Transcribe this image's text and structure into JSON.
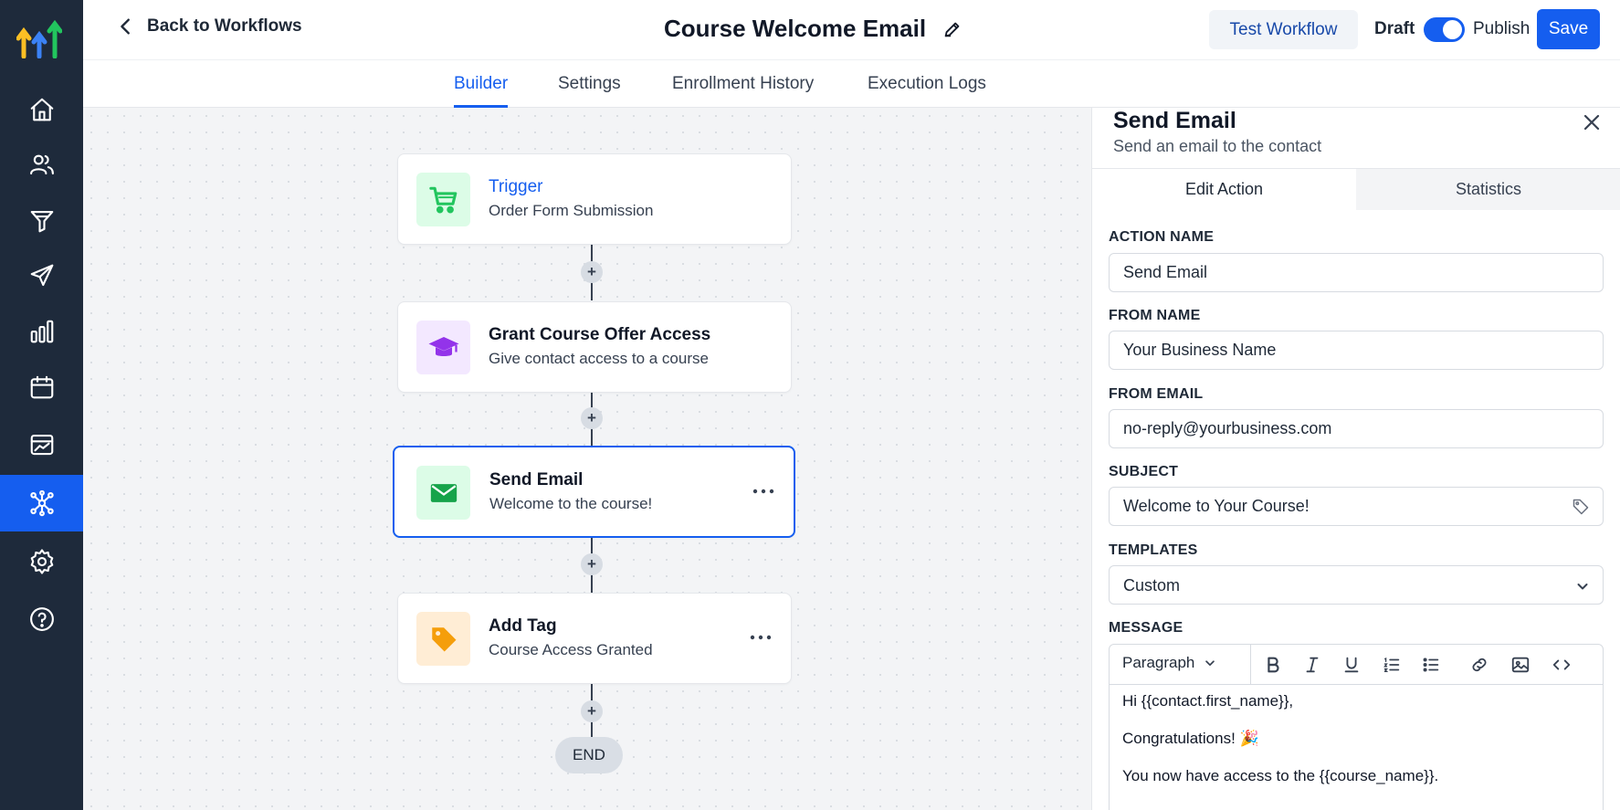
{
  "header": {
    "back_label": "Back to Workflows",
    "title": "Course Welcome Email",
    "test_label": "Test Workflow",
    "draft_label": "Draft",
    "publish_label": "Publish",
    "save_label": "Save"
  },
  "tabs": [
    {
      "label": "Builder",
      "active": true
    },
    {
      "label": "Settings",
      "active": false
    },
    {
      "label": "Enrollment History",
      "active": false
    },
    {
      "label": "Execution Logs",
      "active": false
    }
  ],
  "sidebar": {
    "items": [
      {
        "icon": "home-icon"
      },
      {
        "icon": "contacts-icon"
      },
      {
        "icon": "funnel-icon"
      },
      {
        "icon": "marketing-icon"
      },
      {
        "icon": "reporting-icon"
      },
      {
        "icon": "calendar-icon"
      },
      {
        "icon": "payments-icon"
      },
      {
        "icon": "automation-icon",
        "active": true
      },
      {
        "icon": "settings-icon"
      },
      {
        "icon": "help-icon"
      }
    ]
  },
  "workflow": {
    "nodes": [
      {
        "title": "Trigger",
        "subtitle": "Order Form Submission",
        "icon": "cart-icon",
        "color": "#22c55e"
      },
      {
        "title": "Grant Course Offer Access",
        "subtitle": "Give contact access to a course",
        "icon": "graduation-cap-icon",
        "color": "#9333ea"
      },
      {
        "title": "Send Email",
        "subtitle": "Welcome to the course!",
        "icon": "envelope-icon",
        "color": "#16a34a"
      },
      {
        "title": "Add Tag",
        "subtitle": "Course Access Granted",
        "icon": "tag-icon",
        "color": "#f59e0b"
      }
    ],
    "end_label": "END"
  },
  "panel": {
    "title": "Send Email",
    "subtitle": "Send an email to the contact",
    "tabs": [
      "Edit Action",
      "Statistics"
    ],
    "fields": {
      "action_name_label": "ACTION NAME",
      "action_name_value": "Send Email",
      "from_name_label": "FROM NAME",
      "from_name_value": "Your Business Name",
      "from_email_label": "FROM EMAIL",
      "from_email_value": "no-reply@yourbusiness.com",
      "subject_label": "SUBJECT",
      "subject_value": "Welcome to Your Course!",
      "templates_label": "TEMPLATES",
      "templates_value": "Custom",
      "message_label": "MESSAGE"
    },
    "editor": {
      "paragraph_label": "Paragraph",
      "lines": [
        "Hi {{contact.first_name}},",
        "Congratulations! 🎉",
        "You now have access to the {{course_name}}."
      ]
    }
  },
  "colors": {
    "accent": "#155eef",
    "sidebar": "#1e2a3b"
  }
}
